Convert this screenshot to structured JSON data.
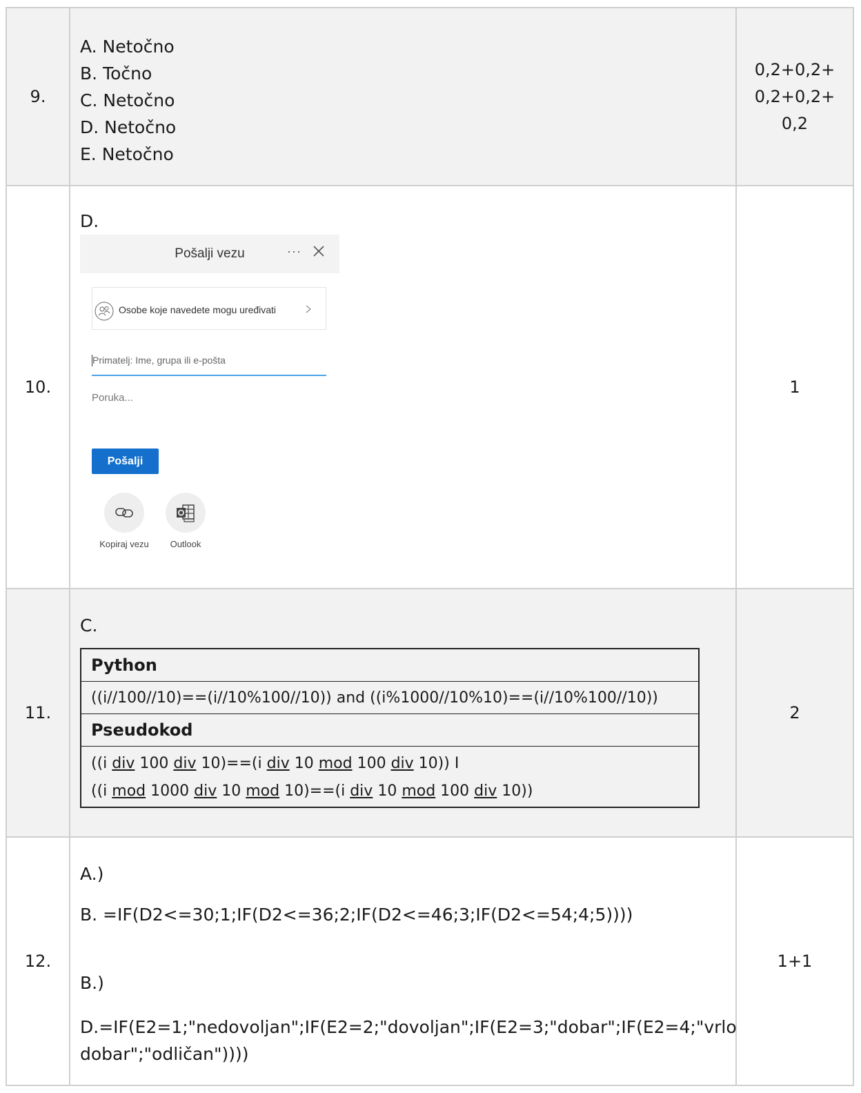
{
  "rows": [
    {
      "num": "9.",
      "answers": [
        "A. Netočno",
        "B. Točno",
        "C. Netočno",
        "D. Netočno",
        "E. Netočno"
      ],
      "points": [
        "0,2+0,2+",
        "0,2+0,2+",
        "0,2"
      ]
    },
    {
      "num": "10.",
      "answer_label": "D.",
      "points": "1",
      "dialog": {
        "title": "Pošalji vezu",
        "more": "···",
        "permission": "Osobe koje navedete mogu uređivati",
        "recipient_placeholder": "Primatelj: Ime, grupa ili e-pošta",
        "message_placeholder": "Poruka...",
        "send_label": "Pošalji",
        "copy_link_label": "Kopiraj vezu",
        "outlook_label": "Outlook",
        "accent_color": "#1470cc"
      }
    },
    {
      "num": "11.",
      "answer_label": "C.",
      "points": "2",
      "python_header": "Python",
      "python_code": "((i//100//10)==(i//10%100//10)) and ((i%1000//10%10)==(i//10%100//10))",
      "pseudo_header": "Pseudokod",
      "pseudo_line1": [
        {
          "t": "((i "
        },
        {
          "t": "div",
          "u": true
        },
        {
          "t": " 100 "
        },
        {
          "t": "div",
          "u": true
        },
        {
          "t": " 10)==(i "
        },
        {
          "t": "div",
          "u": true
        },
        {
          "t": " 10 "
        },
        {
          "t": "mod",
          "u": true
        },
        {
          "t": " 100 "
        },
        {
          "t": "div",
          "u": true
        },
        {
          "t": " 10)) I"
        }
      ],
      "pseudo_line2": [
        {
          "t": "((i "
        },
        {
          "t": "mod",
          "u": true
        },
        {
          "t": " 1000 "
        },
        {
          "t": "div",
          "u": true
        },
        {
          "t": " 10 "
        },
        {
          "t": "mod",
          "u": true
        },
        {
          "t": " 10)==(i "
        },
        {
          "t": "div",
          "u": true
        },
        {
          "t": " 10 "
        },
        {
          "t": "mod",
          "u": true
        },
        {
          "t": " 100 "
        },
        {
          "t": "div",
          "u": true
        },
        {
          "t": " 10))"
        }
      ]
    },
    {
      "num": "12.",
      "points": "1+1",
      "a_label": "A.)",
      "a_answer": "B.  =IF(D2<=30;1;IF(D2<=36;2;IF(D2<=46;3;IF(D2<=54;4;5))))",
      "b_label": "B.)",
      "b_answer": "D.=IF(E2=1;\"nedovoljan\";IF(E2=2;\"dovoljan\";IF(E2=3;\"dobar\";IF(E2=4;\"vrlo dobar\";\"odličan\"))))"
    }
  ]
}
